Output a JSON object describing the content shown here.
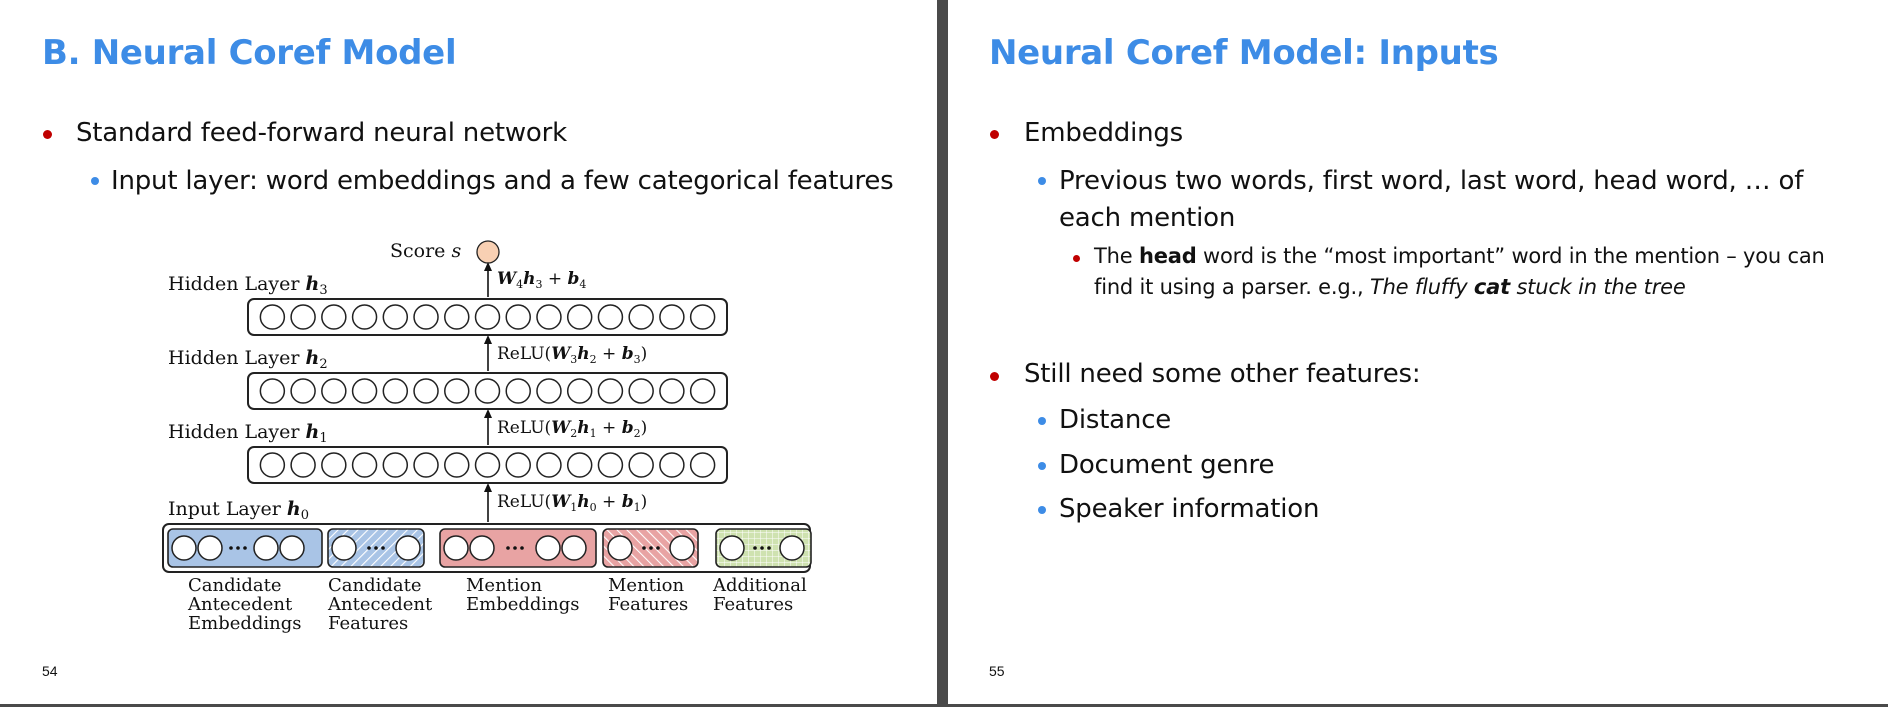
{
  "left_slide": {
    "title": "B. Neural Coref Model",
    "bullet1": "Standard feed-forward neural network",
    "bullet1_sub1": "Input layer: word embeddings and a few categorical features",
    "page_number": "54",
    "diagram": {
      "score_label": "Score",
      "score_var": "s",
      "layers": [
        {
          "label": "Hidden Layer",
          "var": "h",
          "sub": "3"
        },
        {
          "label": "Hidden Layer",
          "var": "h",
          "sub": "2"
        },
        {
          "label": "Hidden Layer",
          "var": "h",
          "sub": "1"
        },
        {
          "label": "Input Layer",
          "var": "h",
          "sub": "0"
        }
      ],
      "transforms": [
        {
          "w": "W",
          "ws": "4",
          "h": "h",
          "hs": "3",
          "b": "b",
          "bs": "4",
          "relu": false
        },
        {
          "w": "W",
          "ws": "3",
          "h": "h",
          "hs": "2",
          "b": "b",
          "bs": "3",
          "relu": true
        },
        {
          "w": "W",
          "ws": "2",
          "h": "h",
          "hs": "1",
          "b": "b",
          "bs": "2",
          "relu": true
        },
        {
          "w": "W",
          "ws": "1",
          "h": "h",
          "hs": "0",
          "b": "b",
          "bs": "1",
          "relu": true
        }
      ],
      "relu_text": "ReLU",
      "input_groups": [
        {
          "lines": [
            "Candidate",
            "Antecedent",
            "Embeddings"
          ],
          "color": "#a9c4e6"
        },
        {
          "lines": [
            "Candidate",
            "Antecedent",
            "Features"
          ],
          "color": "#a9c4e6"
        },
        {
          "lines": [
            "Mention",
            "Embeddings"
          ],
          "color": "#e8a3a3"
        },
        {
          "lines": [
            "Mention",
            "Features"
          ],
          "color": "#e8a3a3"
        },
        {
          "lines": [
            "Additional",
            "Features"
          ],
          "color": "#cfe2b0"
        }
      ]
    }
  },
  "right_slide": {
    "title": "Neural Coref Model: Inputs",
    "bullet1": "Embeddings",
    "bullet1_sub1_line1": "Previous two words, first word, last word, head word, … of",
    "bullet1_sub1_line2": "each mention",
    "sub2_before": "The ",
    "sub2_bold": "head",
    "sub2_after": " word is the “most important” word in the mention – you can",
    "sub2_line2_plain": "find it using a parser. e.g., ",
    "sub2_line2_italic1": "The fluffy ",
    "sub2_line2_bolditalic": "cat",
    "sub2_line2_italic2": " stuck in the tree",
    "bullet2": "Still need some other features:",
    "bullet2_subs": [
      "Distance",
      "Document genre",
      "Speaker information"
    ],
    "page_number": "55"
  },
  "colors": {
    "title": "#3d8ce6",
    "bullet_red": "#c00000",
    "bullet_blue": "#3d8ce6",
    "score_node": "#f8d0b3"
  }
}
